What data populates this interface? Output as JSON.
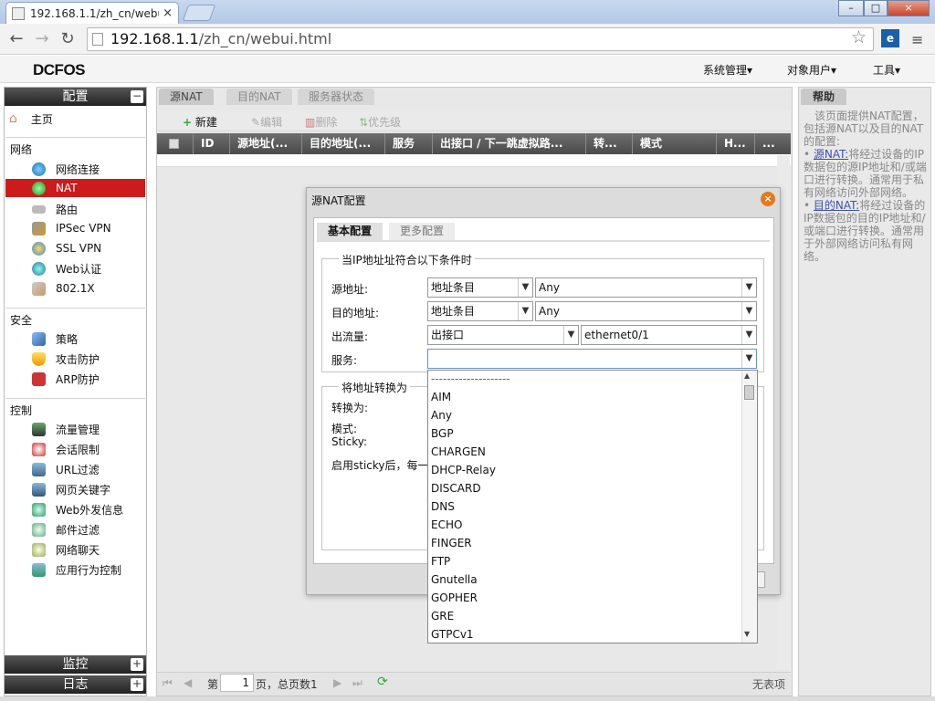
{
  "browser": {
    "tab_title": "192.168.1.1/zh_cn/webu",
    "tab_close": "×",
    "url_host": "192.168.1.1",
    "url_path": "/zh_cn/webui.html",
    "win_min": "–",
    "win_max": "□",
    "win_close": "×",
    "back": "←",
    "forward": "→",
    "reload": "↻",
    "star": "☆",
    "menu": "≡"
  },
  "app": {
    "logo": "DCFOS",
    "topmenu": [
      "系统管理",
      "对象用户",
      "工具"
    ]
  },
  "sidebar": {
    "config_header": "配置",
    "config_toggle": "−",
    "home": "主页",
    "sections": [
      {
        "title": "网络",
        "items": [
          "网络连接",
          "NAT",
          "路由",
          "IPSec VPN",
          "SSL VPN",
          "Web认证",
          "802.1X"
        ]
      },
      {
        "title": "安全",
        "items": [
          "策略",
          "攻击防护",
          "ARP防护"
        ]
      },
      {
        "title": "控制",
        "items": [
          "流量管理",
          "会话限制",
          "URL过滤",
          "网页关键字",
          "Web外发信息",
          "邮件过滤",
          "网络聊天",
          "应用行为控制"
        ]
      }
    ],
    "monitor_header": "监控",
    "log_header": "日志",
    "expand": "+"
  },
  "main": {
    "tabs": [
      "源NAT",
      "目的NAT",
      "服务器状态"
    ],
    "toolbar": [
      "新建",
      "编辑",
      "删除",
      "优先级"
    ],
    "columns": [
      "ID",
      "源地址(...",
      "目的地址(...",
      "服务",
      "出接口 / 下一跳虚拟路...",
      "转...",
      "模式",
      "H...",
      "..."
    ],
    "pager": {
      "page_prefix": "第",
      "page_num": "1",
      "page_suffix": "页，总页数1",
      "status": "无表项"
    }
  },
  "help": {
    "title": "帮助",
    "intro": "该页面提供NAT配置，包括源NAT以及目的NAT的配置:",
    "items": [
      {
        "link": "源NAT:",
        "text": "将经过设备的IP数据包的源IP地址和/或端口进行转换。通常用于私有网络访问外部网络。"
      },
      {
        "link": "目的NAT:",
        "text": "将经过设备的IP数据包的目的IP地址和/或端口进行转换。通常用于外部网络访问私有网络。"
      }
    ]
  },
  "dialog": {
    "title": "源NAT配置",
    "close": "×",
    "tabs": [
      "基本配置",
      "更多配置"
    ],
    "cond_legend": "当IP地址址符合以下条件时",
    "src_label": "源地址:",
    "src_type": "地址条目",
    "src_value": "Any",
    "dst_label": "目的地址:",
    "dst_type": "地址条目",
    "dst_value": "Any",
    "egress_label": "出流量:",
    "egress_type": "出接口",
    "egress_value": "ethernet0/1",
    "service_label": "服务:",
    "service_value": "",
    "trans_legend": "将地址转换为",
    "convert_label": "转换为:",
    "mode_label": "模式:",
    "sticky_label": "Sticky:",
    "sticky_text": "启用sticky后，每一"
  },
  "dropdown": {
    "options": [
      "--------------------",
      "AIM",
      "Any",
      "BGP",
      "CHARGEN",
      "DHCP-Relay",
      "DISCARD",
      "DNS",
      "ECHO",
      "FINGER",
      "FTP",
      "Gnutella",
      "GOPHER",
      "GRE",
      "GTPCv1"
    ]
  },
  "colors": {
    "selected": "#cc1b1b",
    "accent_close": "#e8781c",
    "link": "#3a4fb0"
  }
}
